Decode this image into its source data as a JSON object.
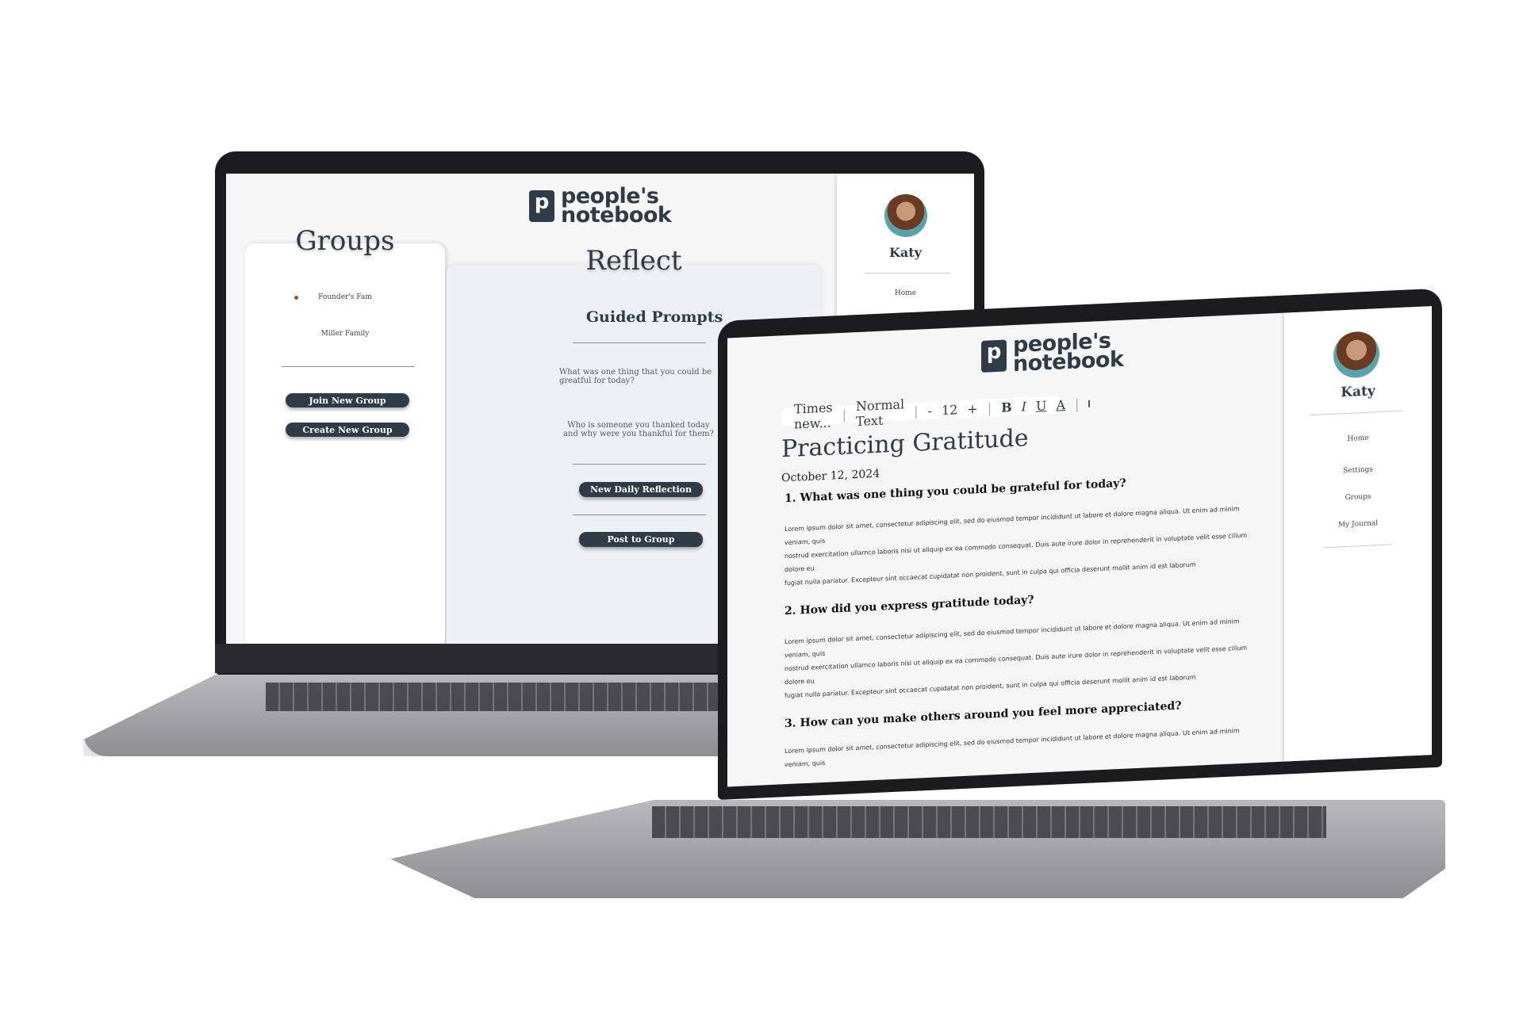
{
  "brand": {
    "line1": "people's",
    "line2": "notebook",
    "mark": "p"
  },
  "user": {
    "name": "Katy"
  },
  "left_screen": {
    "groups": {
      "title": "Groups",
      "items": [
        {
          "label": "Founder's Fam",
          "active": true
        },
        {
          "label": "Miller Family",
          "active": false
        }
      ],
      "join_label": "Join New Group",
      "create_label": "Create New Group"
    },
    "reflect": {
      "title": "Reflect",
      "subtitle": "Guided Prompts",
      "prompts": [
        "What was one thing that you could be greatful for today?",
        "Who is someone you thanked today and why were you thankful for them?"
      ],
      "new_label": "New Daily Reflection",
      "post_label": "Post to Group"
    },
    "nav": [
      "Home"
    ]
  },
  "right_screen": {
    "toolbar": {
      "font": "Times new...",
      "style": "Normal Text",
      "minus": "-",
      "size": "12",
      "plus": "+",
      "bold": "B",
      "italic": "I",
      "underline": "U",
      "color": "A",
      "image_icon": "image-icon"
    },
    "title": "Practicing Gratitude",
    "date": "October 12, 2024",
    "sections": [
      {
        "question": "1. What was one thing you could be grateful for today?",
        "lines": [
          "Lorem ipsum dolor sit amet, consectetur adipiscing elit, sed do eiusmod tempor incididunt ut labore et dolore magna aliqua. Ut enim ad minim veniam, quis",
          "nostrud exercitation ullamco laboris nisi ut aliquip ex ea commodo consequat. Duis aute irure dolor in reprehenderit in voluptate velit esse cillum dolore eu",
          "fugiat nulla pariatur. Excepteur sint occaecat cupidatat non proident, sunt in culpa qui officia deserunt mollit anim id est laborum"
        ]
      },
      {
        "question": "2. How did you express gratitude today?",
        "lines": [
          "Lorem ipsum dolor sit amet, consectetur adipiscing elit, sed do eiusmod tempor incididunt ut labore et dolore magna aliqua. Ut enim ad minim veniam, quis",
          "nostrud exercitation ullamco laboris nisi ut aliquip ex ea commodo consequat. Duis aute irure dolor in reprehenderit in voluptate velit esse cillum dolore eu",
          "fugiat nulla pariatur. Excepteur sint occaecat cupidatat non proident, sunt in culpa qui officia deserunt mollit anim id est laborum"
        ]
      },
      {
        "question": "3. How can you make others around you feel more appreciated?",
        "lines": [
          "Lorem ipsum dolor sit amet, consectetur adipiscing elit, sed do eiusmod tempor incididunt ut labore et dolore magna aliqua. Ut enim ad minim veniam, quis"
        ]
      }
    ],
    "nav": [
      "Home",
      "Settings",
      "Groups",
      "My Journal"
    ]
  },
  "colors": {
    "primary": "#2f3b47",
    "panel": "#edf1f5",
    "active_dot": "#a0522d"
  }
}
